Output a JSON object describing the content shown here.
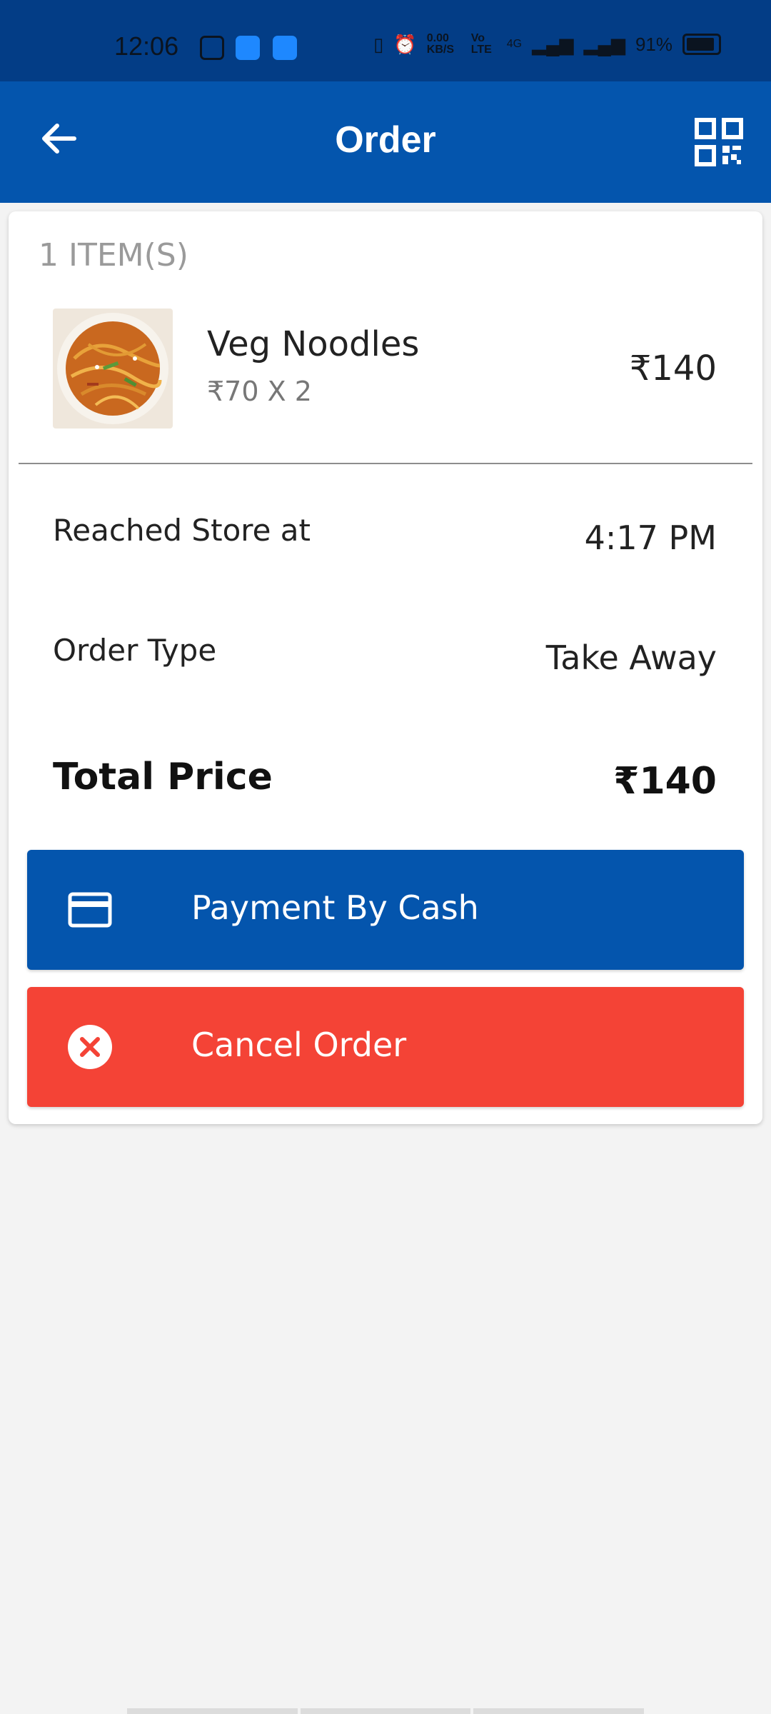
{
  "status_bar": {
    "time": "12:06",
    "network_speed": "0.00 KB/S",
    "volte": "Vo LTE",
    "network_type": "4G",
    "battery": "91%"
  },
  "header": {
    "title": "Order",
    "back_icon": "arrow-left-icon",
    "qr_icon": "qr-code-icon"
  },
  "order": {
    "items_count_label": "1 ITEM(S)",
    "items": [
      {
        "name": "Veg Noodles",
        "unit_price_qty": "₹70 X 2",
        "price": "₹140"
      }
    ],
    "reached_store_label": "Reached Store at",
    "reached_store_time": "4:17 PM",
    "order_type_label": "Order Type",
    "order_type": "Take Away",
    "total_label": "Total Price",
    "total_value": "₹140"
  },
  "actions": {
    "payment_label": "Payment By Cash",
    "payment_icon": "credit-card-icon",
    "cancel_label": "Cancel Order",
    "cancel_icon": "close-circle-icon"
  },
  "colors": {
    "primary": "#0455ad",
    "status_bar": "#033d86",
    "danger": "#f44336",
    "background": "#f3f3f3"
  }
}
